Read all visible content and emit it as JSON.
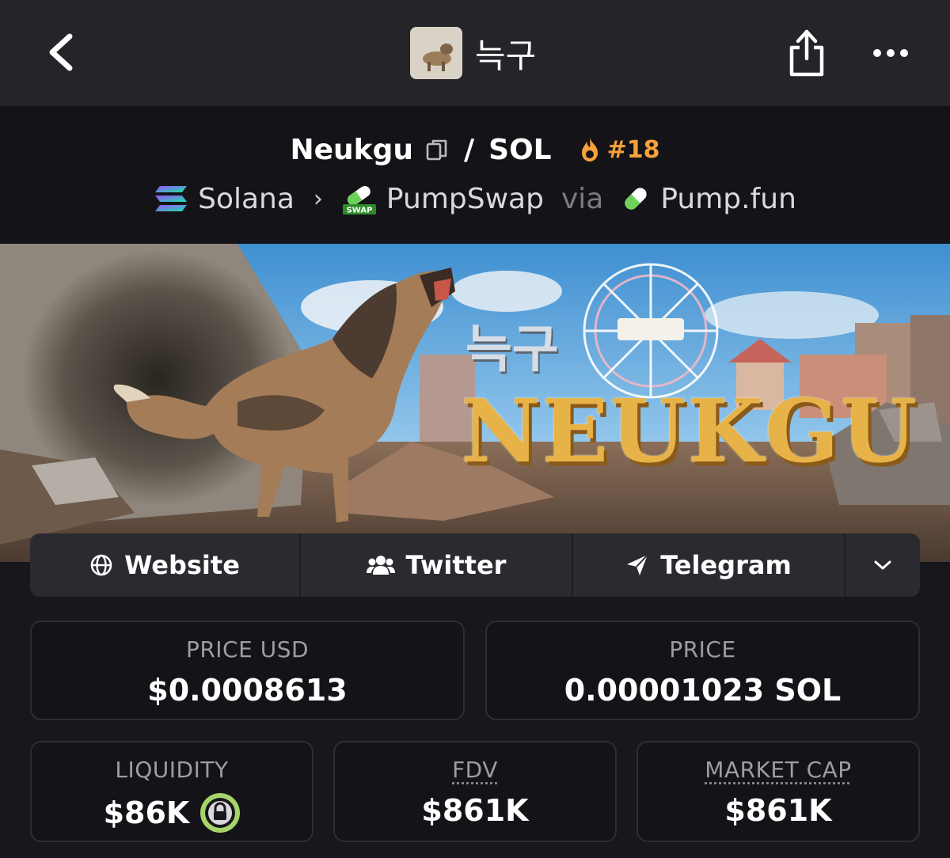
{
  "nav": {
    "title": "늑구"
  },
  "header": {
    "pair_base": "Neukgu",
    "pair_slash": "/",
    "pair_quote": "SOL",
    "rank": "#18",
    "chain": "Solana",
    "dex": "PumpSwap",
    "via": "via",
    "launchpad": "Pump.fun",
    "swap_badge": "SWAP"
  },
  "banner": {
    "korean_text": "늑구",
    "title_text": "NEUKGU"
  },
  "social": {
    "website": "Website",
    "twitter": "Twitter",
    "telegram": "Telegram"
  },
  "stats": {
    "price_usd_label": "PRICE USD",
    "price_usd_value": "$0.0008613",
    "price_label": "PRICE",
    "price_value": "0.00001023 SOL",
    "liquidity_label": "LIQUIDITY",
    "liquidity_value": "$86K",
    "fdv_label": "FDV",
    "fdv_value": "$861K",
    "mcap_label": "MARKET CAP",
    "mcap_value": "$861K"
  },
  "colors": {
    "rank": "#f5a13c",
    "lock": "#a6d46a",
    "banner_title": "#e7b348"
  }
}
